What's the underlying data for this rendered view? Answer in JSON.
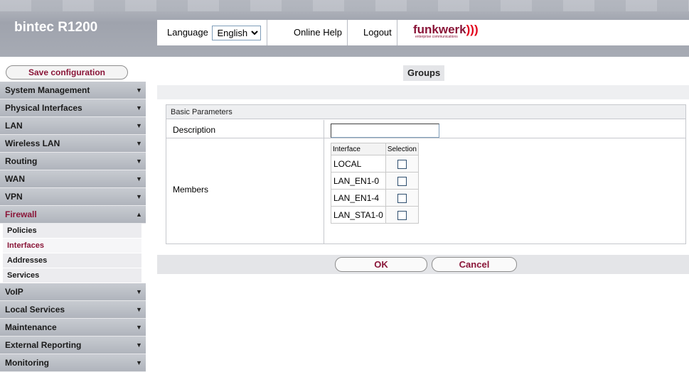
{
  "header": {
    "brand": "bintec R1200",
    "language_label": "Language",
    "language_value": "English",
    "online_help": "Online Help",
    "logout": "Logout",
    "logo_text": "funkwerk",
    "logo_sub": "enterprise communications"
  },
  "sidebar": {
    "save_label": "Save configuration",
    "items": [
      {
        "label": "System Management"
      },
      {
        "label": "Physical Interfaces"
      },
      {
        "label": "LAN"
      },
      {
        "label": "Wireless LAN"
      },
      {
        "label": "Routing"
      },
      {
        "label": "WAN"
      },
      {
        "label": "VPN"
      },
      {
        "label": "Firewall"
      },
      {
        "label": "VoIP"
      },
      {
        "label": "Local Services"
      },
      {
        "label": "Maintenance"
      },
      {
        "label": "External Reporting"
      },
      {
        "label": "Monitoring"
      }
    ],
    "firewall_sub": [
      {
        "label": "Policies"
      },
      {
        "label": "Interfaces"
      },
      {
        "label": "Addresses"
      },
      {
        "label": "Services"
      }
    ]
  },
  "main": {
    "title": "Groups",
    "section": "Basic Parameters",
    "description_label": "Description",
    "description_value": "",
    "members_label": "Members",
    "table_headers": [
      "Interface",
      "Selection"
    ],
    "interfaces": [
      "LOCAL",
      "LAN_EN1-0",
      "LAN_EN1-4",
      "LAN_STA1-0"
    ],
    "ok": "OK",
    "cancel": "Cancel"
  }
}
